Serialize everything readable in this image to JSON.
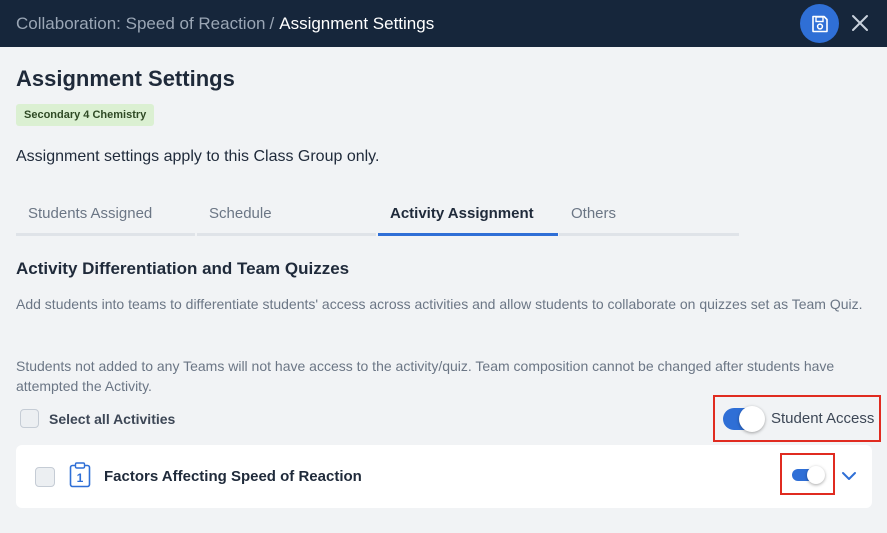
{
  "header": {
    "breadcrumb_parent": "Collaboration: Speed of Reaction",
    "breadcrumb_separator": "/",
    "breadcrumb_current": "Assignment Settings",
    "save_icon": "save-icon",
    "close_icon": "close-icon"
  },
  "page": {
    "title": "Assignment Settings",
    "badge": "Secondary 4 Chemistry",
    "info": "Assignment settings apply to this Class Group only."
  },
  "tabs": [
    {
      "label": "Students Assigned",
      "active": false
    },
    {
      "label": "Schedule",
      "active": false
    },
    {
      "label": "Activity Assignment",
      "active": true
    },
    {
      "label": "Others",
      "active": false
    }
  ],
  "section": {
    "title": "Activity Differentiation and Team Quizzes",
    "desc1": "Add students into teams to differentiate students' access across activities and allow students to collaborate on quizzes set as Team Quiz.",
    "desc2": "Students not added to any Teams will not have access to the activity/quiz. Team composition cannot be changed after students have attempted the Activity."
  },
  "controls": {
    "select_all_label": "Select all Activities",
    "select_all_checked": false,
    "student_access_label": "Student Access",
    "student_access_on": true
  },
  "activities": [
    {
      "title": "Factors Affecting Speed of Reaction",
      "icon_number": "1",
      "checked": false,
      "access_on": true
    }
  ],
  "colors": {
    "header_bg": "#16263b",
    "accent": "#2f6fd6",
    "highlight_border": "#e02b20",
    "badge_bg": "#dbf0d2"
  }
}
